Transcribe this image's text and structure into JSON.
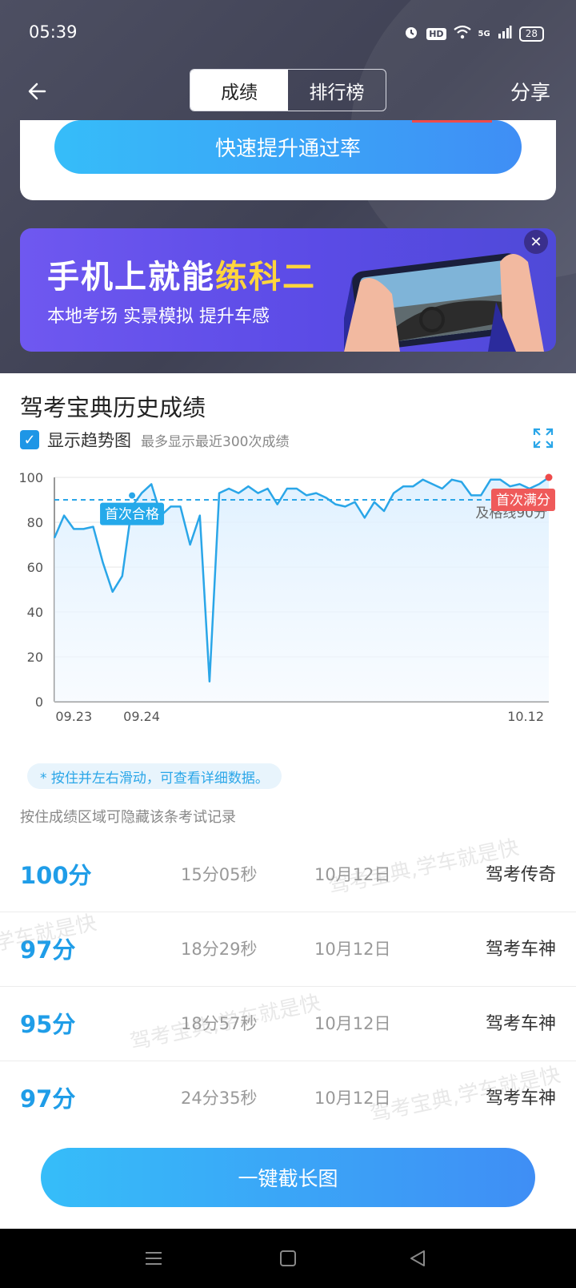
{
  "status_bar": {
    "time": "05:39",
    "network": "5G",
    "battery": "28",
    "hd": "HD"
  },
  "header": {
    "tabs": [
      {
        "label": "成绩"
      },
      {
        "label": "排行榜"
      }
    ],
    "share_label": "分享"
  },
  "card": {
    "button_label": "快速提升通过率"
  },
  "banner": {
    "title_part1": "手机上就能",
    "title_highlight": "练科二",
    "subtitle": "本地考场 实景模拟 提升车感"
  },
  "history": {
    "title": "驾考宝典历史成绩",
    "trend_label": "显示趋势图",
    "trend_note": "最多显示最近300次成绩",
    "hint": "* 按住并左右滑动，可查看详细数据。",
    "hide_tip": "按住成绩区域可隐藏该条考试记录"
  },
  "chart_data": {
    "type": "area",
    "ylim": [
      0,
      100
    ],
    "yticks": [
      "100",
      "80",
      "60",
      "40",
      "20",
      "0"
    ],
    "xticks": [
      "09.23",
      "09.24",
      "10.12"
    ],
    "pass_line": 90,
    "pass_label": "及格线90分",
    "first_pass_label": "首次合格",
    "first_full_label": "首次满分",
    "line_color": "#2aa6e8",
    "values": [
      73,
      83,
      77,
      77,
      78,
      62,
      49,
      56,
      87,
      93,
      97,
      83,
      87,
      87,
      70,
      83,
      9,
      93,
      95,
      93,
      96,
      93,
      95,
      88,
      95,
      95,
      92,
      93,
      91,
      88,
      87,
      89,
      82,
      89,
      85,
      93,
      96,
      96,
      99,
      97,
      95,
      99,
      98,
      92,
      92,
      99,
      99,
      96,
      97,
      95,
      97,
      100
    ],
    "first_pass_index": 9,
    "first_full_index": 51
  },
  "records": [
    {
      "score": "100分",
      "duration": "15分05秒",
      "date": "10月12日",
      "title": "驾考传奇"
    },
    {
      "score": "97分",
      "duration": "18分29秒",
      "date": "10月12日",
      "title": "驾考车神"
    },
    {
      "score": "95分",
      "duration": "18分57秒",
      "date": "10月12日",
      "title": "驾考车神"
    },
    {
      "score": "97分",
      "duration": "24分35秒",
      "date": "10月12日",
      "title": "驾考车神"
    }
  ],
  "watermark": "驾考宝典,学车就是快",
  "long_screenshot_label": "一键截长图"
}
